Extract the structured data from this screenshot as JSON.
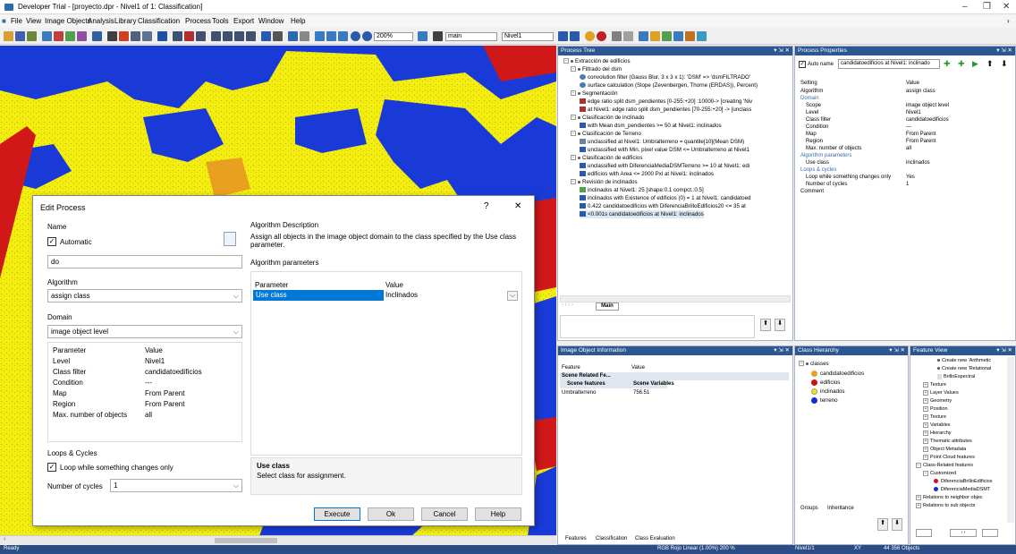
{
  "window": {
    "title": "Developer Trial - [proyecto.dpr - Nivel1 of 1: Classification]",
    "min": "–",
    "max": "❐",
    "close": "✕"
  },
  "menu": [
    "File",
    "View",
    "Image Objects",
    "Analysis",
    "Library",
    "Classification",
    "Process",
    "Tools",
    "Export",
    "Window",
    "Help"
  ],
  "toolbar": {
    "zoom": "200%",
    "layer": "main",
    "level": "Nivel1"
  },
  "process_tree": {
    "title": "Process Tree",
    "rows": [
      "Extracción de edificios",
      "Filtrado del dsm",
      "convolution filter (Gauss Blur, 3 x 3 x 1): 'DSM' => 'dsmFILTRADO'",
      "surface calculation (Slope (Zevenbergen, Thorne (ERDAS)), Percent)",
      "Segmentación",
      "edge ratio split dsm_pendientes [0-255:+20] :10000-> [creating 'Niv",
      "at  Nivel1: edge ratio split dsm_pendientes [70-255:+20] -> [unclass",
      "Clasificación de inclinado",
      "with Mean dsm_pendientes >= 50  at  Nivel1: inclinados",
      "Clasificación de Terreno",
      "unclassified at  Nivel1: Umbralterreno = quantile[10](Mean DSM)",
      "unclassified with Min. pixel value DSM <= Umbralterreno at  Nivel1",
      "Clasificación de edificios",
      "unclassified with DiferenciaMediaDSMTerreno >= 10  at  Nivel1: edi",
      "edificios with Area <= 2000 Pxl  at  Nivel1: inclinados",
      "Revisión de inclinados",
      "inclinados at  Nivel1: 25 [shape:0.1 compct.:0.5]",
      "inclinados with Existence of edificios (0) = 1  at  Nivel1: candidatoed",
      "0.422   candidatoedificios with DiferenciaBrilloEdificios20 <= 35  at",
      "<0.001s   candidatoedificios at  Nivel1: inclinados"
    ],
    "tab": "Main"
  },
  "process_properties": {
    "title": "Process Properties",
    "auto_name_label": "Auto name",
    "auto_name_value": "candidatoedificios at  Nivel1: inclinado",
    "col_setting": "Setting",
    "col_value": "Value",
    "rows": [
      [
        "Algorithm",
        "assign class"
      ],
      [
        "Domain",
        ""
      ],
      [
        "Scope",
        "image object level"
      ],
      [
        "Level",
        "Nivel1"
      ],
      [
        "Class filter",
        "candidatoedificios"
      ],
      [
        "Condition",
        "---"
      ],
      [
        "Map",
        "From Parent"
      ],
      [
        "Region",
        "From Parent"
      ],
      [
        "Max. number of objects",
        "all"
      ],
      [
        "Algorithm parameters",
        ""
      ],
      [
        "Use class",
        "inclinados"
      ],
      [
        "Loops & cycles",
        ""
      ],
      [
        "Loop while something changes only",
        "Yes"
      ],
      [
        "Number of cycles",
        "1"
      ],
      [
        "Comment",
        ""
      ]
    ]
  },
  "image_object_info": {
    "title": "Image Object Information",
    "col_feature": "Feature",
    "col_value": "Value",
    "group": "Scene Related Fe...",
    "subhead_a": "Scene features",
    "subhead_b": "Scene Variables",
    "row_name": "Umbralterreno",
    "row_value": "756.51",
    "tabs": [
      "Features",
      "Classification",
      "Class Evaluation"
    ]
  },
  "class_hierarchy": {
    "title": "Class Hierarchy",
    "root": "classes",
    "classes": [
      {
        "name": "candidatoedificios",
        "color": "#e8a020"
      },
      {
        "name": "edificios",
        "color": "#d01010"
      },
      {
        "name": "inclinados",
        "color": "#f5e800"
      },
      {
        "name": "terreno",
        "color": "#1030d0"
      }
    ],
    "tabs": [
      "Groups",
      "Inheritance"
    ]
  },
  "feature_view": {
    "title": "Feature View",
    "rows": [
      "Create new 'Arithmetic",
      "Create new 'Relational",
      "BrilloEspectral",
      "Texture",
      "Layer Values",
      "Geometry",
      "Position",
      "Texture",
      "Variables",
      "Hierarchy",
      "Thematic attributes",
      "Object Metadata",
      "Point Cloud features",
      "Class-Related features",
      "Customized",
      "DiferenciaBrilloEdificios",
      "DiferenciaMediaDSMT",
      "Relations to neighbor objec",
      "Relations to sub objects"
    ]
  },
  "dialog": {
    "title": "Edit Process",
    "help": "?",
    "close": "✕",
    "name_label": "Name",
    "automatic_label": "Automatic",
    "name_value": "do",
    "algorithm_label": "Algorithm",
    "algorithm_value": "assign class",
    "domain_label": "Domain",
    "domain_value": "image object level",
    "domain_col_param": "Parameter",
    "domain_col_value": "Value",
    "domain_rows": [
      [
        "Level",
        "Nivel1"
      ],
      [
        "Class filter",
        "candidatoedificios"
      ],
      [
        "Condition",
        "---"
      ],
      [
        "Map",
        "From Parent"
      ],
      [
        "Region",
        "From Parent"
      ],
      [
        "Max. number of objects",
        "all"
      ]
    ],
    "loops_label": "Loops & Cycles",
    "loop_check_label": "Loop while something changes only",
    "cycles_label": "Number of cycles",
    "cycles_value": "1",
    "alg_desc_label": "Algorithm Description",
    "alg_desc_text": "Assign all objects in the image object domain to the class specified by the Use class parameter.",
    "alg_params_label": "Algorithm parameters",
    "param_col": "Parameter",
    "value_col": "Value",
    "param_name": "Use class",
    "param_value": "Inclinados",
    "help_title": "Use class",
    "help_text": "Select class for assignment.",
    "btn_execute": "Execute",
    "btn_ok": "Ok",
    "btn_cancel": "Cancel",
    "btn_help": "Help"
  },
  "status": {
    "ready": "Ready",
    "mode": "RGB  Rojo  Linear (1.00%)  200 %",
    "level": "Nivel1/1",
    "xy": "XY",
    "objects": "44 356 Objects"
  }
}
